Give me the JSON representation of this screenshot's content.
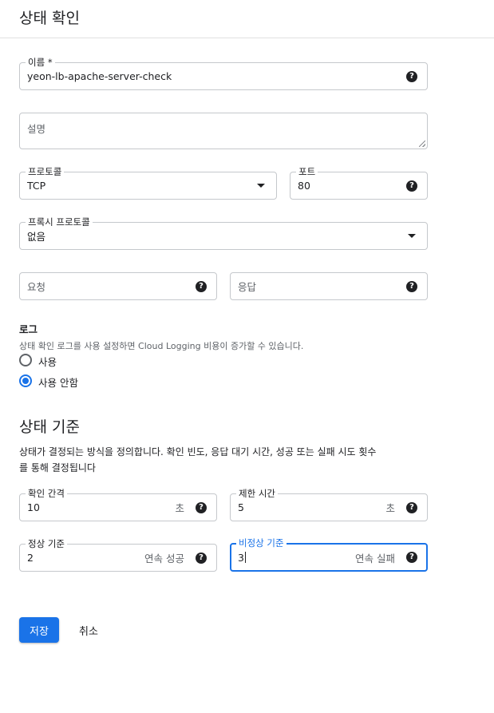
{
  "header": {
    "title": "상태 확인"
  },
  "name_field": {
    "label": "이름 *",
    "value": "yeon-lb-apache-server-check"
  },
  "description_field": {
    "placeholder": "설명"
  },
  "protocol_field": {
    "label": "프로토콜",
    "value": "TCP"
  },
  "port_field": {
    "label": "포트",
    "value": "80"
  },
  "proxy_protocol_field": {
    "label": "프록시 프로토콜",
    "value": "없음"
  },
  "request_field": {
    "placeholder": "요청"
  },
  "response_field": {
    "placeholder": "응답"
  },
  "logs": {
    "title": "로그",
    "description": "상태 확인 로그를 사용 설정하면 Cloud Logging 비용이 증가할 수 있습니다.",
    "options": [
      {
        "label": "사용",
        "checked": false
      },
      {
        "label": "사용 안함",
        "checked": true
      }
    ]
  },
  "criteria": {
    "title": "상태 기준",
    "description_line1": "상태가 결정되는 방식을 정의합니다. 확인 빈도, 응답 대기 시간, 성공 또는 실패 시도 횟수",
    "description_line2": "를 통해 결정됩니다"
  },
  "check_interval_field": {
    "label": "확인 간격",
    "value": "10",
    "suffix": "초"
  },
  "timeout_field": {
    "label": "제한 시간",
    "value": "5",
    "suffix": "초"
  },
  "healthy_threshold_field": {
    "label": "정상 기준",
    "value": "2",
    "suffix": "연속 성공"
  },
  "unhealthy_threshold_field": {
    "label": "비정상 기준",
    "value": "3",
    "suffix": "연속 실패"
  },
  "actions": {
    "save_label": "저장",
    "cancel_label": "취소"
  },
  "icons": {
    "help": "?"
  },
  "colors": {
    "accent": "#1a73e8",
    "text": "#202124",
    "border": "#c5c8cc"
  }
}
